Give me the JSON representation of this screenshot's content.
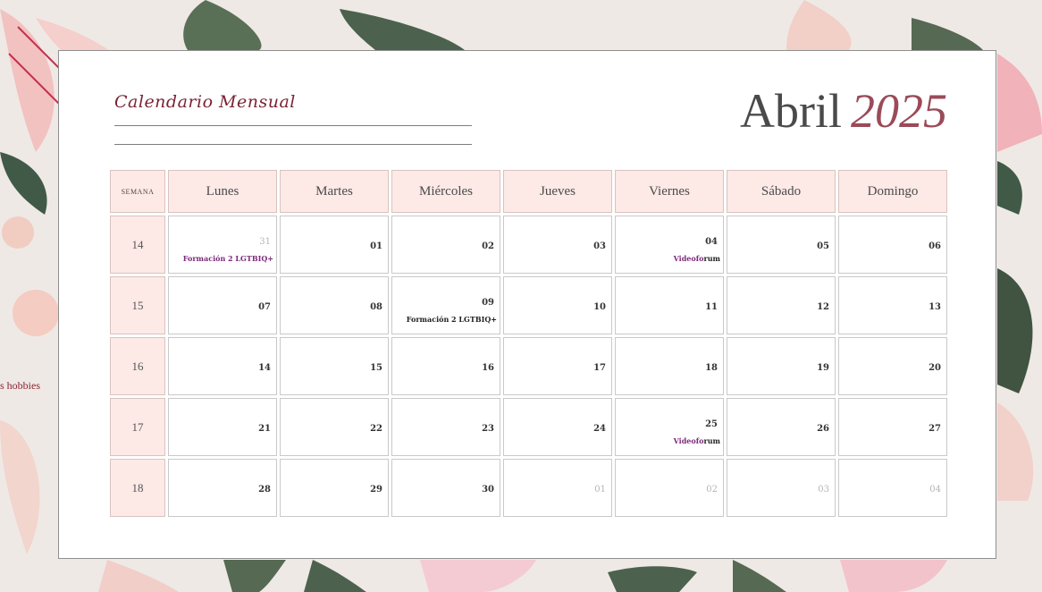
{
  "side_text": "s hobbies",
  "header": {
    "subtitle": "Calendario Mensual",
    "month": "Abril",
    "year": "2025"
  },
  "table": {
    "week_header": "SEMANA",
    "days": [
      "Lunes",
      "Martes",
      "Miércoles",
      "Jueves",
      "Viernes",
      "Sábado",
      "Domingo"
    ],
    "weeks": [
      {
        "week": "14",
        "cells": [
          {
            "day": "31",
            "muted": true,
            "event": "Formación 2 LGTBIQ+",
            "event_style": "purple"
          },
          {
            "day": "01"
          },
          {
            "day": "02"
          },
          {
            "day": "03"
          },
          {
            "day": "04",
            "event_parts": [
              "Videofo",
              "rum"
            ]
          },
          {
            "day": "05"
          },
          {
            "day": "06"
          }
        ]
      },
      {
        "week": "15",
        "cells": [
          {
            "day": "07"
          },
          {
            "day": "08"
          },
          {
            "day": "09",
            "event": "Formación 2 LGTBIQ+",
            "event_style": "dark"
          },
          {
            "day": "10"
          },
          {
            "day": "11"
          },
          {
            "day": "12"
          },
          {
            "day": "13"
          }
        ]
      },
      {
        "week": "16",
        "cells": [
          {
            "day": "14"
          },
          {
            "day": "15"
          },
          {
            "day": "16"
          },
          {
            "day": "17"
          },
          {
            "day": "18"
          },
          {
            "day": "19"
          },
          {
            "day": "20"
          }
        ]
      },
      {
        "week": "17",
        "cells": [
          {
            "day": "21"
          },
          {
            "day": "22"
          },
          {
            "day": "23"
          },
          {
            "day": "24"
          },
          {
            "day": "25",
            "event_parts": [
              "Videofo",
              "rum"
            ]
          },
          {
            "day": "26"
          },
          {
            "day": "27"
          }
        ]
      },
      {
        "week": "18",
        "cells": [
          {
            "day": "28"
          },
          {
            "day": "29"
          },
          {
            "day": "30"
          },
          {
            "day": "01",
            "muted": true
          },
          {
            "day": "02",
            "muted": true
          },
          {
            "day": "03",
            "muted": true
          },
          {
            "day": "04",
            "muted": true
          }
        ]
      }
    ]
  },
  "colors": {
    "accent": "#7b2334",
    "header_fill": "#fde9e6",
    "event_purple": "#7b2a7a"
  }
}
